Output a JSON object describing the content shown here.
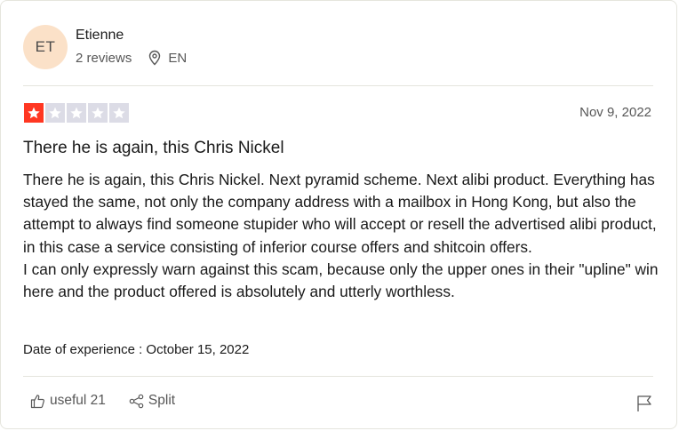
{
  "consumer": {
    "initials": "ET",
    "name": "Etienne",
    "reviews": "2 reviews",
    "country": "EN",
    "location_icon": "location-pin-icon"
  },
  "review": {
    "rating": 1,
    "max_rating": 5,
    "date": "Nov 9, 2022",
    "title": "There he is again, this Chris Nickel",
    "body": "There he is again, this Chris Nickel. Next pyramid scheme. Next alibi product. Everything has stayed the same, not only the company address with a mailbox in Hong Kong, but also the attempt to always find someone stupider who will accept or resell the advertised alibi product, in this case a service consisting of inferior course offers and shitcoin offers.\nI can only expressly warn against this scam, because only the upper ones in their \"upline\" win here and the product offered is absolutely and utterly worthless.",
    "experience": "Date of experience : October 15, 2022"
  },
  "actions": {
    "useful_label": "useful 21",
    "split_label": "Split",
    "useful_icon": "thumbs-up-icon",
    "split_icon": "share-icon",
    "flag_icon": "flag-icon"
  },
  "colors": {
    "star_active": "#ff3722",
    "star_inactive": "#dcdce6",
    "avatar_bg": "#fbe1c8",
    "divider": "#e5e5dd"
  }
}
